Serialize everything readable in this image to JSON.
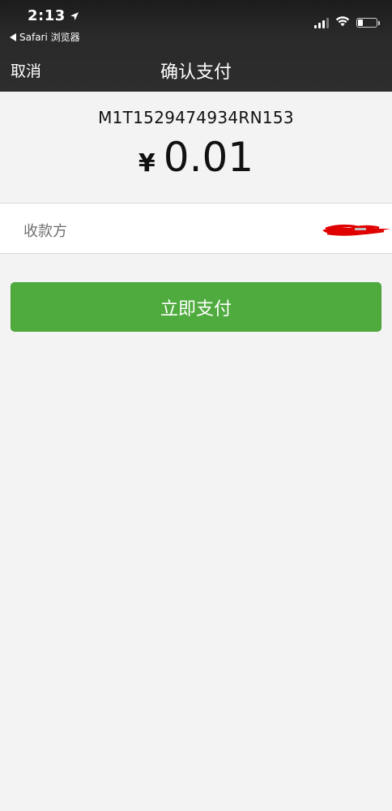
{
  "status_bar": {
    "time": "2:13",
    "back_app_label": "Safari 浏览器"
  },
  "nav": {
    "cancel_label": "取消",
    "title": "确认支付"
  },
  "payment": {
    "order_number": "M1T1529474934RN153",
    "currency_symbol": "¥",
    "amount": "0.01"
  },
  "payee": {
    "label": "收款方"
  },
  "pay_button": {
    "label": "立即支付",
    "color": "#4fab3d"
  },
  "icons": {
    "location": "location-arrow-icon",
    "back": "back-triangle-icon",
    "signal": "cellular-signal-icon",
    "wifi": "wifi-icon",
    "battery": "battery-icon"
  },
  "battery_level": 0.3
}
